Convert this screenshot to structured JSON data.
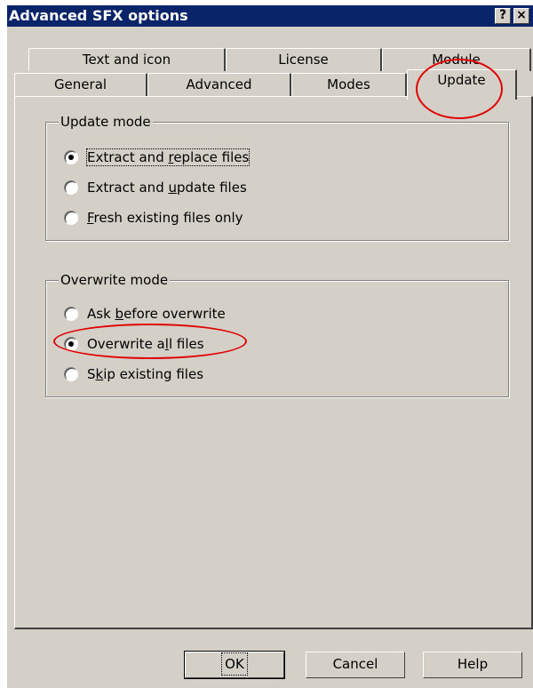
{
  "window": {
    "title": "Advanced SFX options",
    "help_label": "?",
    "close_label": "×"
  },
  "tabs_top": [
    {
      "label": "Text and icon"
    },
    {
      "label": "License"
    },
    {
      "label": "Module"
    }
  ],
  "tabs_bottom": [
    {
      "label": "General"
    },
    {
      "label": "Advanced"
    },
    {
      "label": "Modes"
    },
    {
      "label": "Update",
      "active": true
    }
  ],
  "update_mode": {
    "legend": "Update mode",
    "options": [
      {
        "pre": "Extract and ",
        "mnemonic": "r",
        "post": "eplace files",
        "checked": true
      },
      {
        "pre": "Extract and ",
        "mnemonic": "u",
        "post": "pdate files",
        "checked": false
      },
      {
        "pre": "",
        "mnemonic": "F",
        "post": "resh existing files only",
        "checked": false
      }
    ]
  },
  "overwrite_mode": {
    "legend": "Overwrite mode",
    "options": [
      {
        "pre": "Ask ",
        "mnemonic": "b",
        "post": "efore overwrite",
        "checked": false
      },
      {
        "pre": "Overwrite a",
        "mnemonic": "l",
        "post": "l files",
        "checked": true
      },
      {
        "pre": "S",
        "mnemonic": "k",
        "post": "ip existing files",
        "checked": false
      }
    ]
  },
  "buttons": {
    "ok": "OK",
    "cancel": "Cancel",
    "help": "Help"
  },
  "colors": {
    "title_bar": "#0a246a",
    "dialog_face": "#d4d0c8",
    "annotation": "#e00000"
  }
}
